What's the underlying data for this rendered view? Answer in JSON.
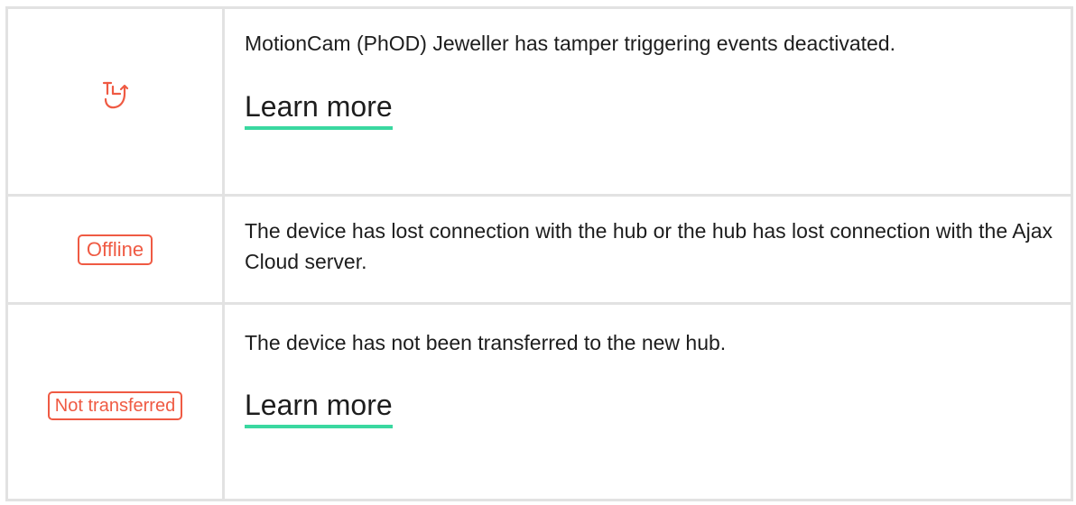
{
  "rows": [
    {
      "icon": "tamper-deactivated-icon",
      "description": "MotionCam (PhOD) Jeweller has tamper triggering events deactivated.",
      "link": "Learn more"
    },
    {
      "badge": "Offline",
      "description": "The device has lost connection with the hub or the hub has lost connection with the Ajax Cloud server."
    },
    {
      "badge": "Not transferred",
      "description": "The device has not been transferred to the new hub.",
      "link": "Learn more"
    }
  ],
  "colors": {
    "accent_red": "#ef5a43",
    "link_underline": "#3ad8a0",
    "border": "#e2e2e2"
  }
}
